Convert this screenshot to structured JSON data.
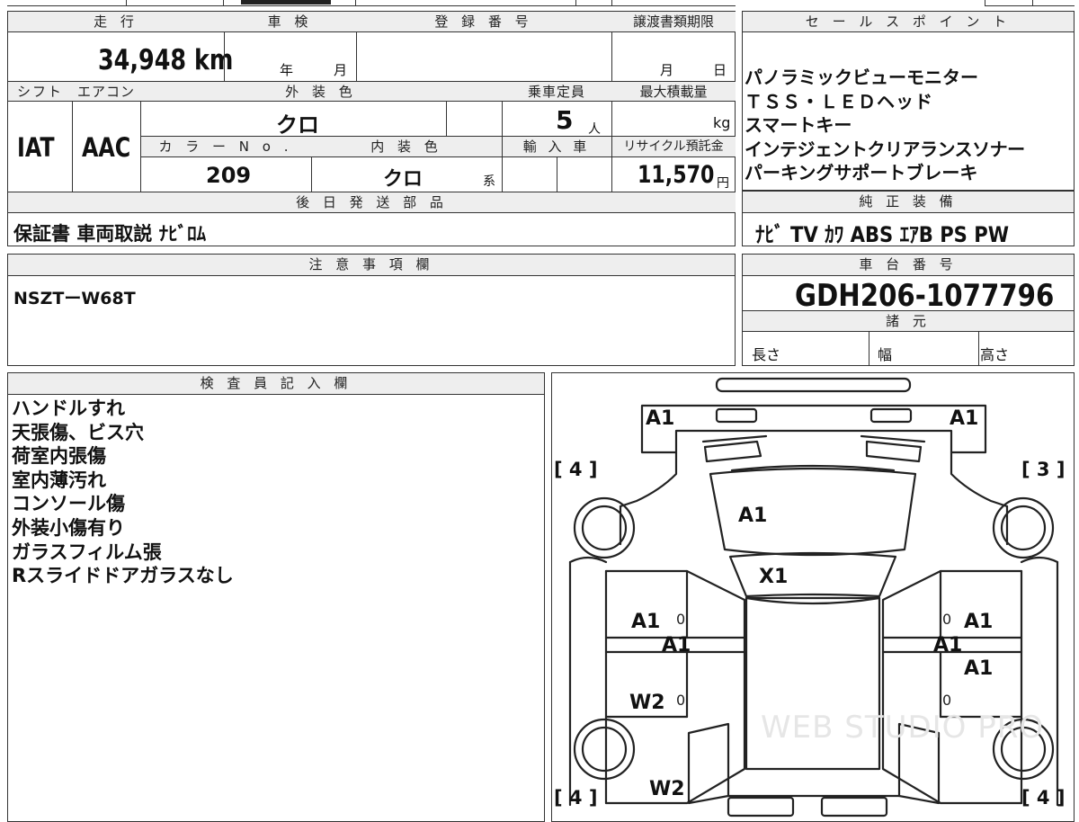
{
  "headers": {
    "mileage": "走 行",
    "inspection": "車 検",
    "registration": "登 録 番 号",
    "transfer_deadline": "譲渡書類期限",
    "sales_points": "セ ー ル ス ポ イ ン ト",
    "shift": "シフト",
    "aircon": "エアコン",
    "exterior_color": "外 装 色",
    "capacity": "乗車定員",
    "max_load": "最大積載量",
    "color_no": "カ ラ ー N o .",
    "interior_color": "内 装 色",
    "import": "輸 入 車",
    "recycle": "リサイクル預託金",
    "later_parts": "後 日 発 送 部 品",
    "genuine_equipment": "純 正 装 備",
    "notes": "注 意 事 項 欄",
    "chassis_no": "車 台 番 号",
    "specs": "諸 元",
    "inspector": "検 査 員 記 入 欄"
  },
  "vehicle": {
    "mileage_value": "34,948",
    "mileage_unit": "km",
    "inspection_year_unit": "年",
    "inspection_month_unit": "月",
    "deadline_month_unit": "月",
    "deadline_day_unit": "日",
    "shift": "IAT",
    "aircon": "AAC",
    "exterior_color": "クロ",
    "capacity": "5",
    "capacity_unit": "人",
    "max_load_unit": "kg",
    "color_no": "209",
    "interior_color": "クロ",
    "interior_suffix": "系",
    "recycle_fee": "11,570",
    "recycle_unit": "円",
    "chassis_no": "GDH206-1077796"
  },
  "sales_points": [
    "パノラミックビューモニター",
    "ＴＳＳ・ＬＥＤヘッド",
    "スマートキー",
    "インテジェントクリアランスソナー",
    "パーキングサポートブレーキ"
  ],
  "later_parts": "保証書 車両取説 ﾅﾋﾞﾛﾑ",
  "genuine_equipment": "ﾅﾋﾞ TV ｶﾜ ABS ｴｱB PS PW",
  "notes_text": "NSZTーW68T",
  "specs": {
    "length": "長さ",
    "width": "幅",
    "height": "高さ"
  },
  "inspector_notes": [
    "ハンドルすれ",
    "天張傷、ビス穴",
    "荷室内張傷",
    "室内薄汚れ",
    "コンソール傷",
    "外装小傷有り",
    "ガラスフィルム張",
    "Rスライドドアガラスなし"
  ],
  "diagram": {
    "tire_front_left": "[ 4 ]",
    "tire_front_right": "[ 3 ]",
    "tire_rear_left": "[ 4 ]",
    "tire_rear_right": "[ 4 ]",
    "marks": {
      "front_left_corner": "A1",
      "front_right_corner": "A1",
      "windshield": "A1",
      "roof_front": "X1",
      "left_front_door": "A1",
      "left_front_door_zero": "0",
      "left_rocker": "A1",
      "left_rear_door": "W2",
      "left_rear_door_zero": "0",
      "left_rear_quarter": "W2",
      "right_front_door_zero": "0",
      "right_front_door": "A1",
      "right_rocker": "A1",
      "right_rear_door": "A1",
      "right_rear_door_zero": "0"
    },
    "watermark": "WEB STUDIO PRO"
  }
}
